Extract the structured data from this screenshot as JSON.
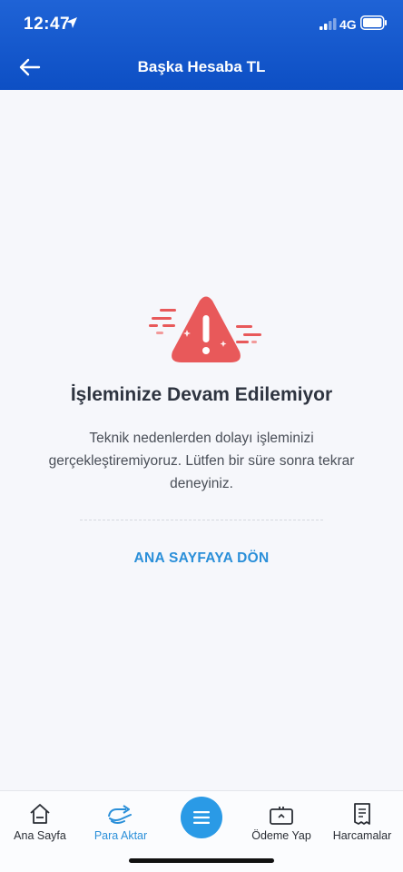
{
  "status": {
    "time": "12:47",
    "network": "4G"
  },
  "header": {
    "title": "Başka Hesaba TL"
  },
  "error": {
    "title": "İşleminize Devam Edilemiyor",
    "message": "Teknik nedenlerden dolayı işleminizi gerçekleştiremiyoruz. Lütfen bir süre sonra tekrar deneyiniz.",
    "action": "ANA SAYFAYA DÖN"
  },
  "tabs": [
    {
      "label": "Ana Sayfa",
      "icon": "home-icon"
    },
    {
      "label": "Para Aktar",
      "icon": "transfer-icon"
    },
    {
      "label": "",
      "icon": "menu-icon"
    },
    {
      "label": "Ödeme Yap",
      "icon": "payment-icon"
    },
    {
      "label": "Harcamalar",
      "icon": "receipt-icon"
    }
  ],
  "colors": {
    "header": "#1f63d6",
    "accent": "#2a8fd9",
    "warning": "#e8595a",
    "menu": "#2a9ae6"
  }
}
